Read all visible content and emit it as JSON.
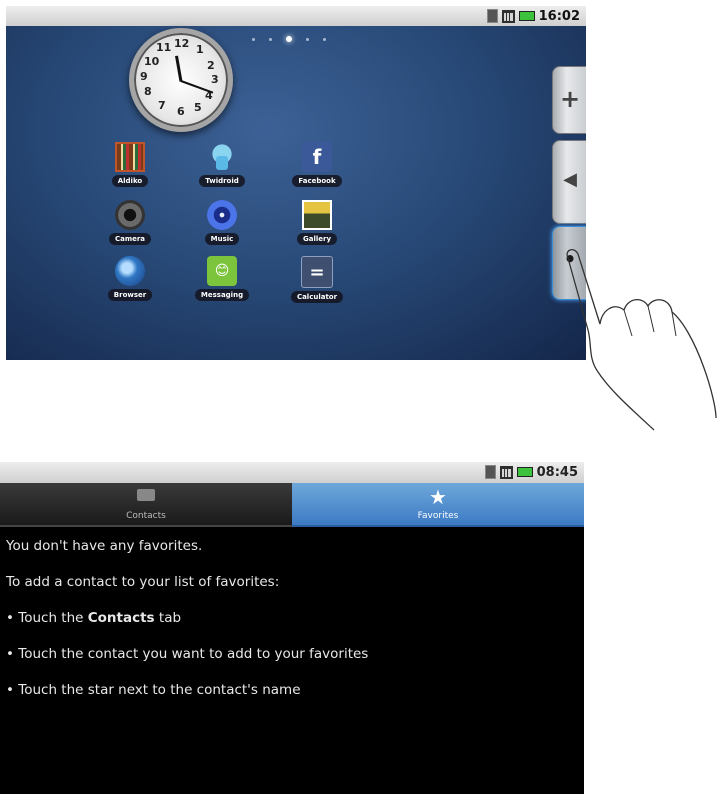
{
  "home": {
    "status_time": "16:02",
    "clock_numbers": [
      "12",
      "1",
      "2",
      "3",
      "4",
      "5",
      "6",
      "7",
      "8",
      "9",
      "10",
      "11"
    ],
    "apps": [
      {
        "label": "Aldiko",
        "icon": "aldiko-icon"
      },
      {
        "label": "Twidroid",
        "icon": "twidroid-icon"
      },
      {
        "label": "Facebook",
        "icon": "facebook-icon",
        "glyph": "f"
      },
      {
        "label": "Camera",
        "icon": "camera-icon"
      },
      {
        "label": "Music",
        "icon": "music-icon"
      },
      {
        "label": "Gallery",
        "icon": "gallery-icon"
      },
      {
        "label": "Browser",
        "icon": "browser-icon"
      },
      {
        "label": "Messaging",
        "icon": "messaging-icon",
        "glyph": "😊"
      },
      {
        "label": "Calculator",
        "icon": "calculator-icon",
        "glyph": "="
      }
    ],
    "side_tabs": {
      "plus": "+",
      "play": "◀",
      "dot": "•"
    }
  },
  "favorites": {
    "status_time": "08:45",
    "tabs": {
      "contacts": "Contacts",
      "favorites": "Favorites"
    },
    "line1": "You don't have any favorites.",
    "line2": "To add a contact to your list of favorites:",
    "bullet1_pre": "• Touch the ",
    "bullet1_bold": "Contacts",
    "bullet1_post": " tab",
    "bullet2": "• Touch the contact you want to add to your favorites",
    "bullet3": "• Touch the star next to the contact's name"
  },
  "colors": {
    "tab_active": "#4a8ad0",
    "screen_bg": "#284a78",
    "battery": "#3cc23c"
  }
}
